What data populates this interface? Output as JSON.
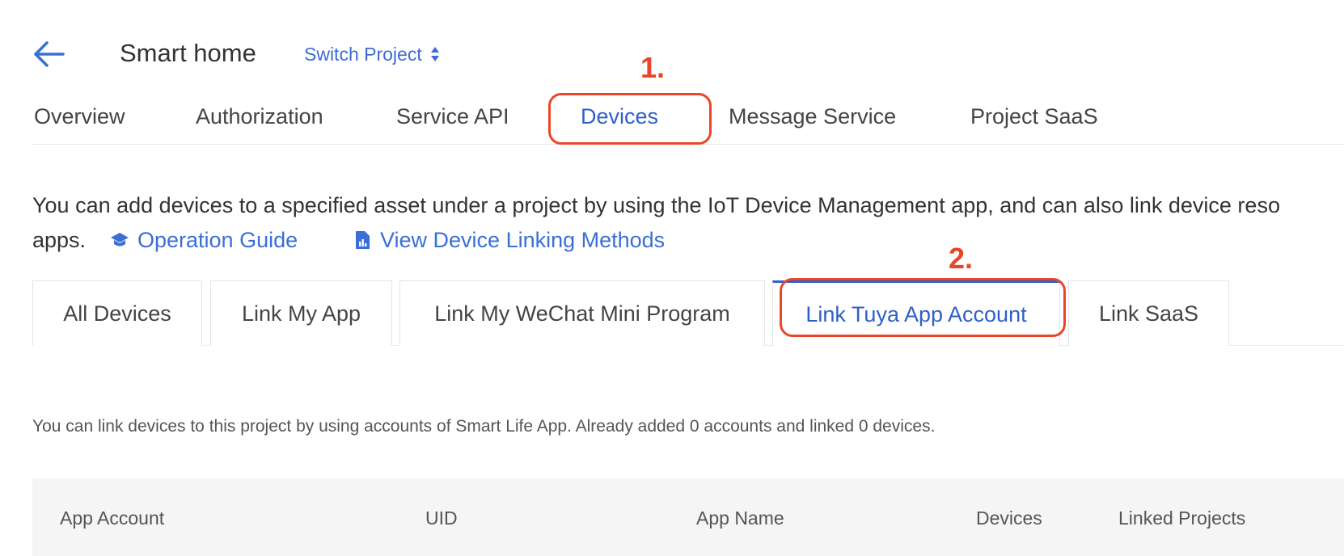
{
  "header": {
    "title": "Smart home",
    "switch_project_label": "Switch Project"
  },
  "annotations": {
    "marker_1": "1.",
    "marker_2": "2."
  },
  "nav_tabs": [
    {
      "label": "Overview"
    },
    {
      "label": "Authorization"
    },
    {
      "label": "Service API"
    },
    {
      "label": "Devices",
      "active": true
    },
    {
      "label": "Message Service"
    },
    {
      "label": "Project SaaS"
    }
  ],
  "description": {
    "line1": "You can add devices to a specified asset under a project by using the IoT Device Management app, and can also link device reso",
    "line2": "apps.",
    "operation_guide": "Operation Guide",
    "view_methods": "View Device Linking Methods"
  },
  "sub_tabs": [
    {
      "label": "All Devices"
    },
    {
      "label": "Link My App"
    },
    {
      "label": "Link My WeChat Mini Program"
    },
    {
      "label": "Link Tuya App Account",
      "active": true
    },
    {
      "label": "Link SaaS"
    }
  ],
  "info_text": "You can link devices to this project by using accounts of Smart Life App. Already added 0 accounts and linked 0 devices.",
  "table": {
    "columns": [
      "App Account",
      "UID",
      "App Name",
      "Devices",
      "Linked Projects"
    ]
  },
  "colors": {
    "accent": "#2f5fc8",
    "link": "#3a6fd8",
    "annotation": "#e8472a"
  }
}
